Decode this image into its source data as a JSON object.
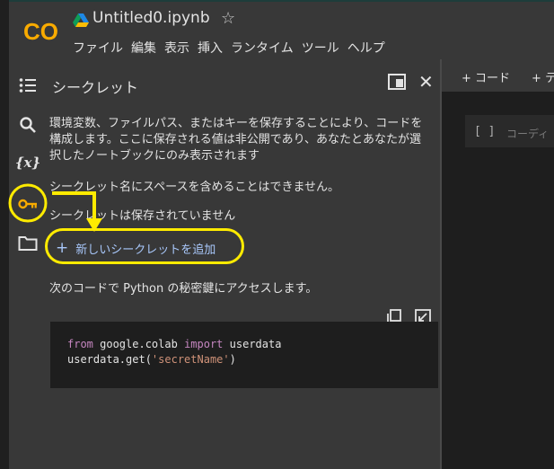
{
  "app": {
    "logo_text": "CO",
    "notebook_title": "Untitled0.ipynb"
  },
  "menu": [
    "ファイル",
    "編集",
    "表示",
    "挿入",
    "ランタイム",
    "ツール",
    "ヘルプ"
  ],
  "sidebar_icons": [
    "toc-icon",
    "search-icon",
    "variables-icon",
    "key-icon",
    "folder-icon"
  ],
  "variables_icon_text": "{x}",
  "secrets_panel": {
    "title": "シークレット",
    "description": "環境変数、ファイルパス、またはキーを保存することにより、コードを構成します。ここに保存される値は非公開であり、あなたとあなたが選択したノートブックにのみ表示されます",
    "space_warning": "シークレット名にスペースを含めることはできません。",
    "empty_status": "シークレットは保存されていません",
    "add_button": "新しいシークレットを追加",
    "access_text": "次のコードで Python の秘密鍵にアクセスします。",
    "code": {
      "kw_from": "from",
      "module": " google.colab ",
      "kw_import": "import",
      "name": " userdata",
      "line2_prefix": "userdata.get(",
      "line2_string": "'secretName'",
      "line2_suffix": ")"
    }
  },
  "editor": {
    "add_code": "+ コード",
    "add_text": "+ テ",
    "cell_bracket": "[ ]",
    "cell_placeholder": "コーディ"
  },
  "colors": {
    "highlight": "#ffeb00",
    "logo_orange": "#f9ab00",
    "link_blue": "#a8c7fa",
    "key_icon": "#f9ab00"
  }
}
